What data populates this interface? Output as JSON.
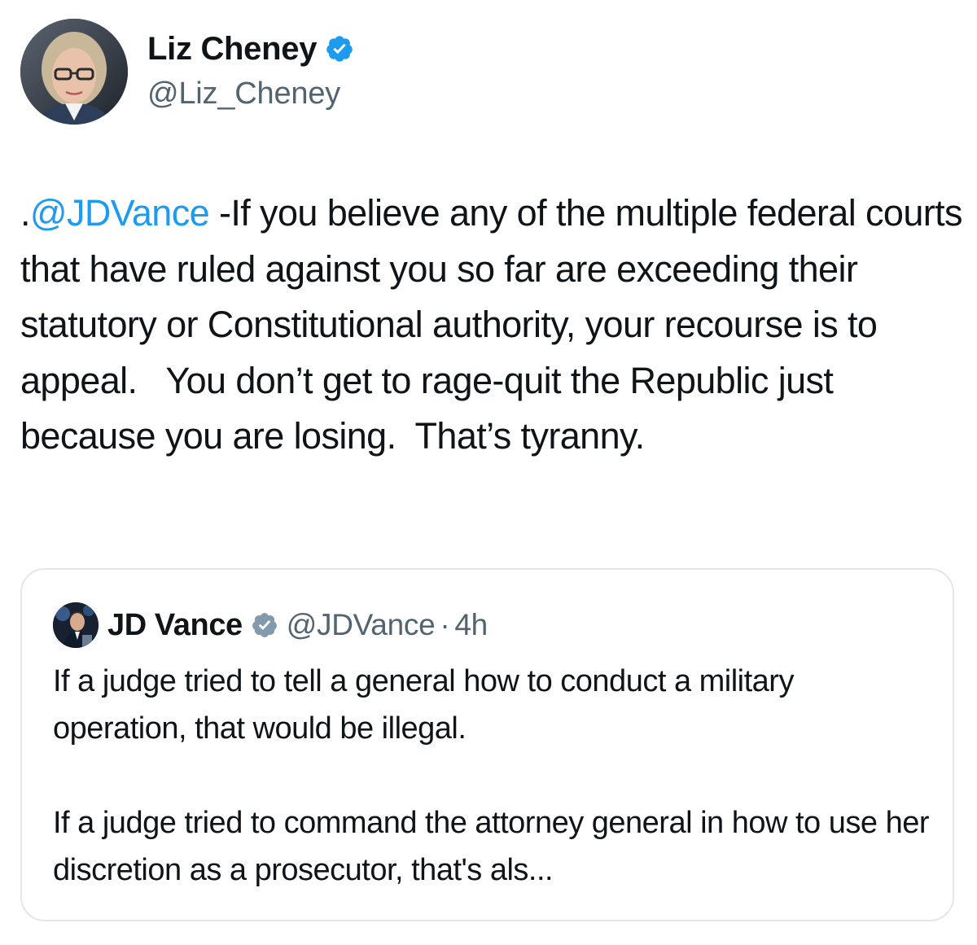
{
  "author": {
    "name": "Liz Cheney",
    "handle": "@Liz_Cheney",
    "verified_color": "#1d9bf0"
  },
  "tweet": {
    "prefix": ".",
    "mention": "@JDVance",
    "body": " -If you believe any of the multiple federal courts that have ruled against you so far are exceeding their statutory or Constitutional authority, your recourse is to appeal.   You don’t get to rage-quit the Republic just because you are losing.  That’s tyranny.",
    "mention_color": "#1d9bf0"
  },
  "quote": {
    "name": "JD Vance",
    "handle": "@JDVance",
    "separator": "·",
    "time": "4h",
    "verified_color": "#829aab",
    "paragraphs": [
      "If a judge tried to tell a general how to conduct a military operation, that would be illegal.",
      "If a judge tried to command the attorney general in how to use her discretion as a prosecutor, that's als..."
    ]
  }
}
